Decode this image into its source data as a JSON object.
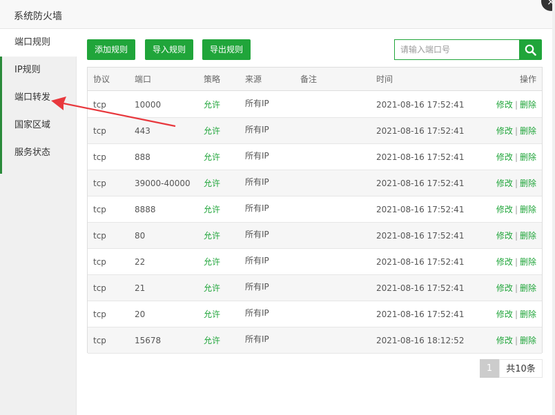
{
  "dialog": {
    "title": "系统防火墙",
    "close_icon": "×"
  },
  "sidebar": {
    "items": [
      {
        "label": "端口规则",
        "active": true
      },
      {
        "label": "IP规则",
        "active": false
      },
      {
        "label": "端口转发",
        "active": false
      },
      {
        "label": "国家区域",
        "active": false
      },
      {
        "label": "服务状态",
        "active": false
      }
    ]
  },
  "toolbar": {
    "add_label": "添加规则",
    "import_label": "导入规则",
    "export_label": "导出规则",
    "search_placeholder": "请输入端口号",
    "search_icon": "search-icon"
  },
  "table": {
    "headers": {
      "proto": "协议",
      "port": "端口",
      "policy": "策略",
      "source": "来源",
      "note": "备注",
      "time": "时间",
      "op": "操作"
    },
    "rows": [
      {
        "proto": "tcp",
        "port": "10000",
        "policy": "允许",
        "source": "所有IP",
        "note": "",
        "time": "2021-08-16 17:52:41",
        "edit": "修改",
        "delete": "删除"
      },
      {
        "proto": "tcp",
        "port": "443",
        "policy": "允许",
        "source": "所有IP",
        "note": "",
        "time": "2021-08-16 17:52:41",
        "edit": "修改",
        "delete": "删除"
      },
      {
        "proto": "tcp",
        "port": "888",
        "policy": "允许",
        "source": "所有IP",
        "note": "",
        "time": "2021-08-16 17:52:41",
        "edit": "修改",
        "delete": "删除"
      },
      {
        "proto": "tcp",
        "port": "39000-40000",
        "policy": "允许",
        "source": "所有IP",
        "note": "",
        "time": "2021-08-16 17:52:41",
        "edit": "修改",
        "delete": "删除"
      },
      {
        "proto": "tcp",
        "port": "8888",
        "policy": "允许",
        "source": "所有IP",
        "note": "",
        "time": "2021-08-16 17:52:41",
        "edit": "修改",
        "delete": "删除"
      },
      {
        "proto": "tcp",
        "port": "80",
        "policy": "允许",
        "source": "所有IP",
        "note": "",
        "time": "2021-08-16 17:52:41",
        "edit": "修改",
        "delete": "删除"
      },
      {
        "proto": "tcp",
        "port": "22",
        "policy": "允许",
        "source": "所有IP",
        "note": "",
        "time": "2021-08-16 17:52:41",
        "edit": "修改",
        "delete": "删除"
      },
      {
        "proto": "tcp",
        "port": "21",
        "policy": "允许",
        "source": "所有IP",
        "note": "",
        "time": "2021-08-16 17:52:41",
        "edit": "修改",
        "delete": "删除"
      },
      {
        "proto": "tcp",
        "port": "20",
        "policy": "允许",
        "source": "所有IP",
        "note": "",
        "time": "2021-08-16 17:52:41",
        "edit": "修改",
        "delete": "删除"
      },
      {
        "proto": "tcp",
        "port": "15678",
        "policy": "允许",
        "source": "所有IP",
        "note": "",
        "time": "2021-08-16 18:12:52",
        "edit": "修改",
        "delete": "删除"
      }
    ],
    "separator": "|"
  },
  "pagination": {
    "current_page": "1",
    "total": "共10条"
  },
  "colors": {
    "accent": "#20a53a",
    "annotation_arrow": "#e8383d"
  }
}
